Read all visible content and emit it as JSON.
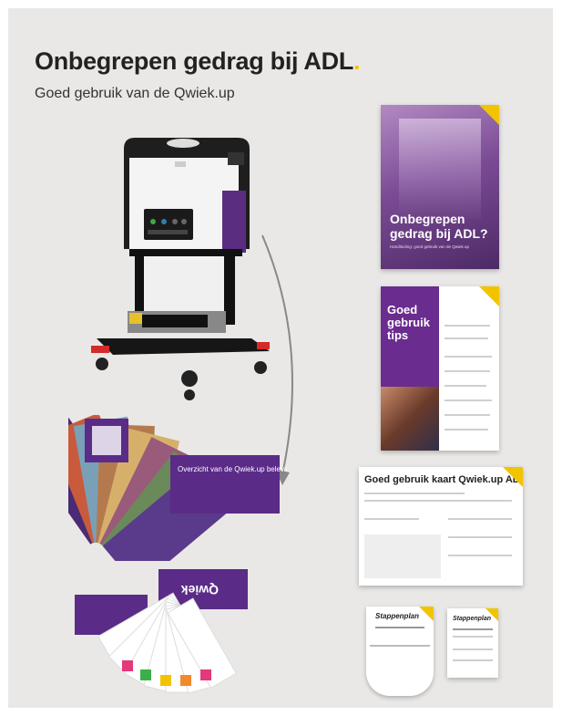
{
  "header": {
    "title": "Onbegrepen gedrag bij ADL",
    "title_dot": ".",
    "subtitle": "Goed gebruik van de Qwiek.up"
  },
  "booklet_cover": {
    "title": "Onbegrepen gedrag bij ADL?",
    "subtitle": "Handleiding: goed gebruik van de Qwiek.up"
  },
  "booklet_tips": {
    "title": "Goed gebruik tips"
  },
  "fan_cards": {
    "top_label": "Overzicht van de Qwiek.up belevingsmodules",
    "bottom_label": "Qwiek"
  },
  "adl_card": {
    "title": "Goed gebruik kaart Qwiek.up ADL"
  },
  "stappenplan": {
    "label_1": "Stappenplan",
    "label_2": "Stappenplan"
  },
  "colors": {
    "brand_purple": "#6a2c8e",
    "accent_yellow": "#f2c400",
    "background": "#e9e8e6"
  }
}
